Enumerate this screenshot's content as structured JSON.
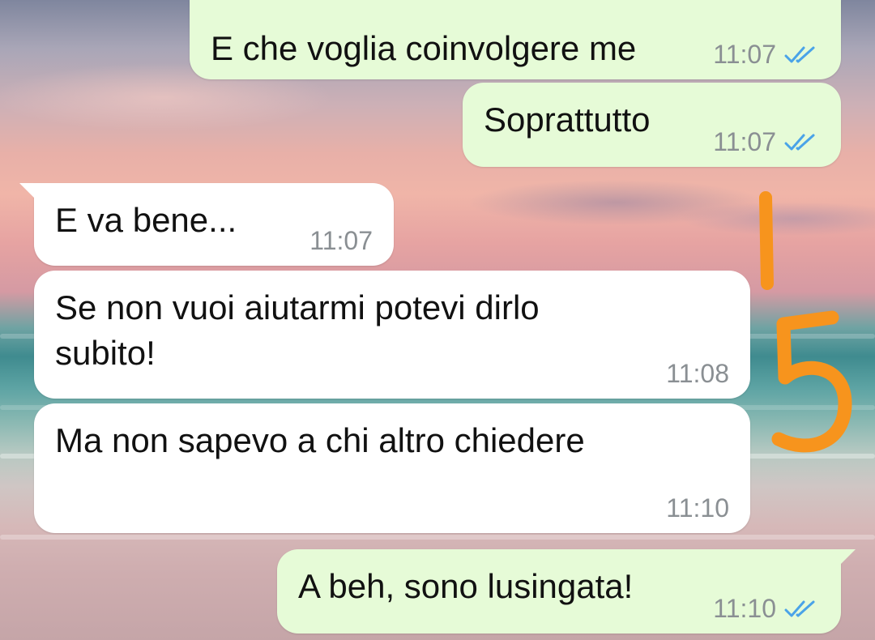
{
  "chat": {
    "messages": [
      {
        "direction": "outgoing",
        "text": "E che voglia coinvolgere me",
        "time": "11:07",
        "status": "read"
      },
      {
        "direction": "outgoing",
        "text": "Soprattutto",
        "time": "11:07",
        "status": "read"
      },
      {
        "direction": "incoming",
        "text": "E va bene...",
        "time": "11:07"
      },
      {
        "direction": "incoming",
        "text": "Se non vuoi aiutarmi potevi dirlo subito!",
        "time": "11:08"
      },
      {
        "direction": "incoming",
        "text": "Ma non sapevo a chi altro chiedere",
        "time": "11:10"
      },
      {
        "direction": "outgoing",
        "text": "A beh, sono lusingata!",
        "time": "11:10",
        "status": "read"
      }
    ]
  },
  "annotation": {
    "glyphs": "1 5",
    "color": "#f7941d"
  },
  "colors": {
    "outgoing_bubble": "#e6fbd7",
    "incoming_bubble": "#ffffff",
    "read_ticks": "#4aa3e8"
  }
}
